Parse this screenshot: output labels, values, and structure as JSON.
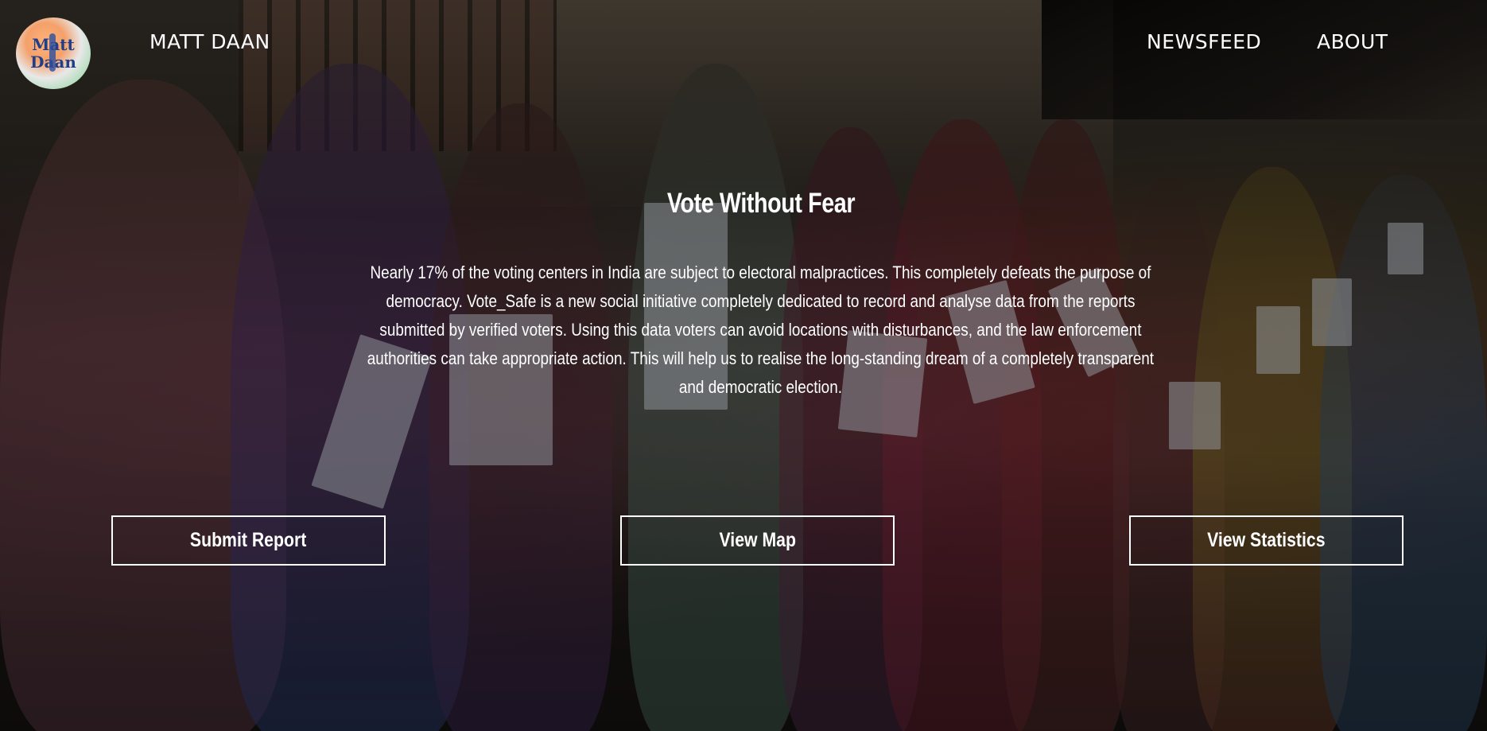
{
  "nav": {
    "logo_text_top": "Matt",
    "logo_text_bottom": "Daan",
    "brand": "MATT DAAN",
    "links": [
      {
        "label": "NEWSFEED"
      },
      {
        "label": "ABOUT"
      }
    ]
  },
  "hero": {
    "headline": "Vote Without Fear",
    "description": "Nearly 17% of the voting centers in India are subject to electoral malpractices. This completely defeats the purpose of democracy. Vote_Safe is a new social initiative completely dedicated to record and analyse data from the reports submitted by verified voters. Using this data voters can avoid locations with disturbances, and the law enforcement authorities can take appropriate action. This will help us to realise the long-standing dream of a completely transparent and democratic election."
  },
  "actions": {
    "submit_label": "Submit Report",
    "map_label": "View Map",
    "stats_label": "View Statistics"
  },
  "colors": {
    "text": "#ffffff",
    "button_border": "#ffffff",
    "logo_saffron": "#f4a06a",
    "logo_green": "#7bd08f",
    "logo_text": "#1f3f8a"
  }
}
